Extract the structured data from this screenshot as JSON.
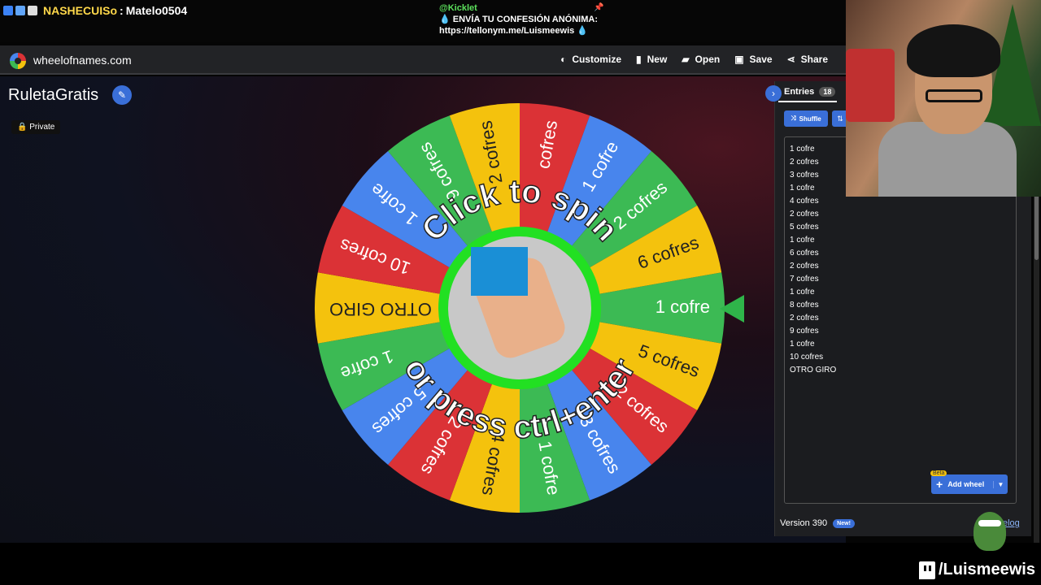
{
  "stream_chat": {
    "username": "NASHECUISo",
    "separator": ":",
    "message": "Matelo0504"
  },
  "confession": {
    "handle": "@Kicklet",
    "line1": "ENVÍA TU CONFESIÓN ANÓNIMA:",
    "line2": "https://tellonym.me/Luismeewis",
    "drop": "💧"
  },
  "site": {
    "name": "wheelofnames.com",
    "menu": [
      {
        "label": "Customize",
        "icon": "palette-icon"
      },
      {
        "label": "New",
        "icon": "file-icon"
      },
      {
        "label": "Open",
        "icon": "folder-icon"
      },
      {
        "label": "Save",
        "icon": "save-icon"
      },
      {
        "label": "Share",
        "icon": "share-icon"
      }
    ]
  },
  "page": {
    "title": "RuletaGratis",
    "privacy": "Private"
  },
  "wheel": {
    "top_text": "Click to spin",
    "bottom_text": "or press ctrl+enter",
    "colors": [
      "#3cba54",
      "#f4c20d",
      "#db3236",
      "#4885ed"
    ],
    "hub_color": "#22e022",
    "slices": [
      "1 cofre",
      "5 cofres",
      "2 cofres",
      "3 cofres",
      "1 cofre",
      "4 cofres",
      "2 cofres",
      "5 cofres",
      "1 cofre",
      "OTRO GIRO",
      "10 cofres",
      "1 cofre",
      "9 cofres",
      "2 cofres",
      "cofres",
      "1 cofre",
      "2 cofres",
      "6 cofres"
    ]
  },
  "entries": {
    "tab_label": "Entries",
    "count": "18",
    "shuffle_label": "Shuffle",
    "items": [
      "1 cofre",
      "2 cofres",
      "3 cofres",
      "1 cofre",
      "4 cofres",
      "2 cofres",
      "5 cofres",
      "1 cofre",
      "6 cofres",
      "2 cofres",
      "7 cofres",
      "1 cofre",
      "8 cofres",
      "2 cofres",
      "9 cofres",
      "1 cofre",
      "10 cofres",
      "OTRO GIRO"
    ],
    "add_wheel_label": "Add wheel",
    "beta_label": "Beta",
    "version_label": "Version 390",
    "new_badge": "New!",
    "changelog": "elog"
  },
  "stream_footer": {
    "channel": "/Luismeewis"
  }
}
